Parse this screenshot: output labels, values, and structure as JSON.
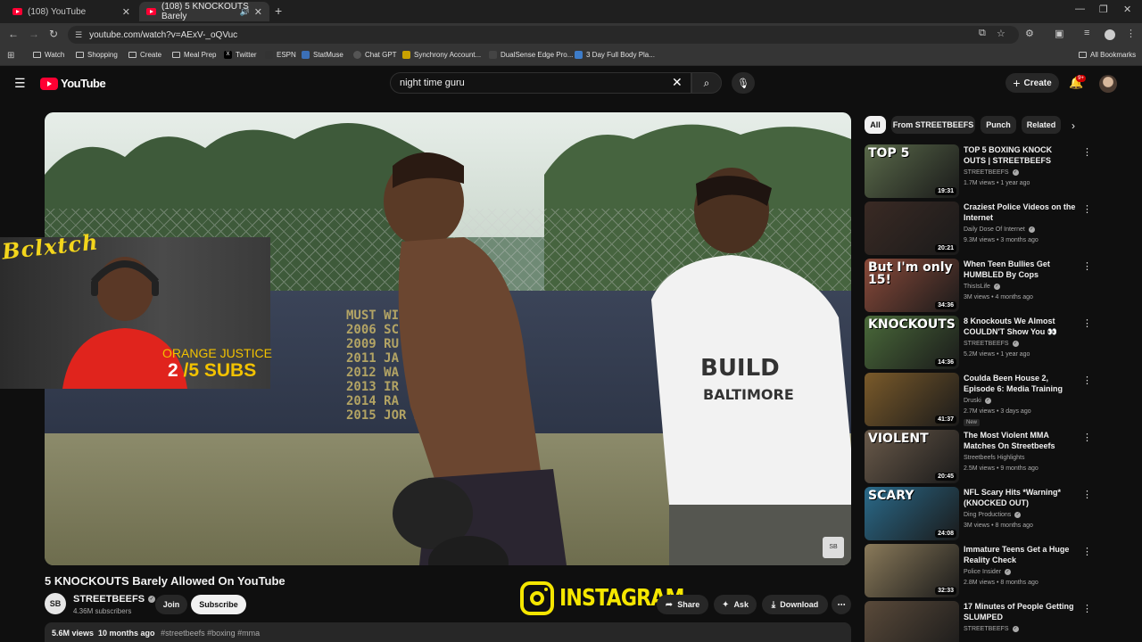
{
  "browser": {
    "tabs": [
      {
        "label": "(108) YouTube"
      },
      {
        "label": "(108) 5 KNOCKOUTS Barely"
      }
    ],
    "url": "youtube.com/watch?v=AExV-_oQVuc",
    "bookmarks": [
      {
        "label": "Watch"
      },
      {
        "label": "Shopping"
      },
      {
        "label": "Create"
      },
      {
        "label": "Meal Prep"
      },
      {
        "label": "Twitter"
      },
      {
        "label": "ESPN"
      },
      {
        "label": "StatMuse"
      },
      {
        "label": "Chat GPT"
      },
      {
        "label": "Synchrony Account..."
      },
      {
        "label": "DualSense Edge Pro..."
      },
      {
        "label": "3 Day Full Body Pla..."
      }
    ],
    "all_bookmarks": "All Bookmarks"
  },
  "youtube": {
    "logo_text": "YouTube",
    "search_value": "night time guru",
    "create_label": "Create",
    "notification_count": "9+"
  },
  "video": {
    "title": "5 KNOCKOUTS Barely Allowed On YouTube",
    "channel": "STREETBEEFS",
    "subscribers": "4.36M subscribers",
    "join_label": "Join",
    "subscribe_label": "Subscribe",
    "actions": {
      "share": "Share",
      "ask": "Ask",
      "download": "Download"
    },
    "views": "5.6M views",
    "age": "10 months ago",
    "tags": "#streetbeefs #boxing #mma",
    "wall_text": [
      "MUST WIN",
      "2006 SC    WINS",
      "2009 RU   L WINS",
      "2011 JA    T 9 WINS",
      "2012 WA",
      "2013 IR",
      "2014 RA",
      "2015 JOR      MARE"
    ],
    "shirt_text": "BUILD BALTIMORE"
  },
  "overlay": {
    "signature": "Bclxtch",
    "goal_label": "ORANGE JUSTICE",
    "goal_current": "2",
    "goal_total": "/5 SUBS",
    "instagram": "INSTAGRAM"
  },
  "chips": [
    {
      "label": "All"
    },
    {
      "label": "From STREETBEEFS"
    },
    {
      "label": "Punch"
    },
    {
      "label": "Related"
    }
  ],
  "recommendations": [
    {
      "title": "TOP 5 BOXING KNOCK OUTS | STREETBEEFS",
      "channel": "STREETBEEFS",
      "verified": true,
      "meta": "1.7M views • 1 year ago",
      "duration": "19:31",
      "caption": "TOP 5",
      "bg": "#5a6a4a"
    },
    {
      "title": "Craziest Police Videos on the Internet",
      "channel": "Daily Dose Of Internet",
      "verified": true,
      "meta": "9.3M views • 3 months ago",
      "duration": "20:21",
      "caption": "",
      "bg": "#3a2a24"
    },
    {
      "title": "When Teen Bullies Get HUMBLED By Cops",
      "channel": "ThisIsLife",
      "verified": true,
      "meta": "3M views • 4 months ago",
      "duration": "34:36",
      "caption": "But I'm only 15!",
      "bg": "#8a4a3a"
    },
    {
      "title": "8 Knockouts We Almost COULDN'T Show You 👀",
      "channel": "STREETBEEFS",
      "verified": true,
      "meta": "5.2M views • 1 year ago",
      "duration": "14:36",
      "caption": "KNOCKOUTS",
      "bg": "#4a6a3a"
    },
    {
      "title": "Coulda Been House 2, Episode 6: Media Training",
      "channel": "Druski",
      "verified": true,
      "meta": "2.7M views • 3 days ago",
      "duration": "41:37",
      "caption": "",
      "bg": "#7a5a2a",
      "new": "New"
    },
    {
      "title": "The Most Violent MMA Matches On Streetbeefs",
      "channel": "Streetbeefs Highlights",
      "verified": false,
      "meta": "2.5M views • 9 months ago",
      "duration": "20:45",
      "caption": "VIOLENT",
      "bg": "#6a5a4a"
    },
    {
      "title": "NFL Scary Hits *Warning* (KNOCKED OUT)",
      "channel": "Ding Productions",
      "verified": true,
      "meta": "3M views • 8 months ago",
      "duration": "24:08",
      "caption": "SCARY",
      "bg": "#2a6a8a"
    },
    {
      "title": "Immature Teens Get a Huge Reality Check",
      "channel": "Police Insider",
      "verified": true,
      "meta": "2.8M views • 8 months ago",
      "duration": "32:33",
      "caption": "",
      "bg": "#8a7a5a"
    },
    {
      "title": "17 Minutes of People Getting SLUMPED",
      "channel": "STREETBEEFS",
      "verified": true,
      "meta": "",
      "duration": "",
      "caption": "",
      "bg": "#5a4a3a"
    }
  ]
}
